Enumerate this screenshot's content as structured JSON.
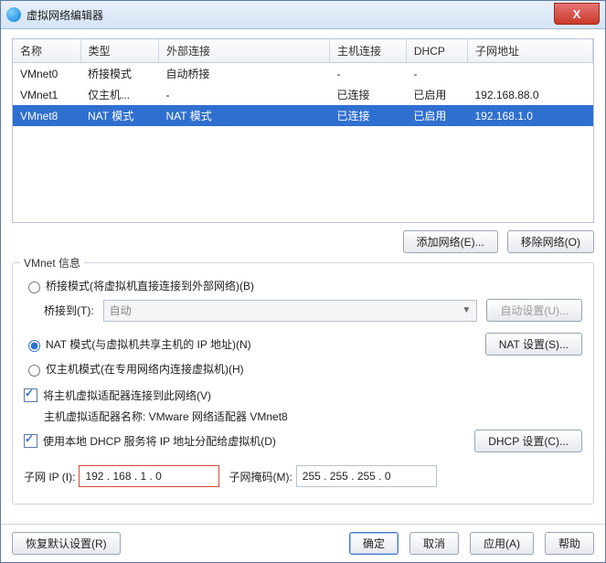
{
  "window": {
    "title": "虚拟网络编辑器",
    "close": "X"
  },
  "table": {
    "headers": {
      "name": "名称",
      "type": "类型",
      "ext": "外部连接",
      "host": "主机连接",
      "dhcp": "DHCP",
      "subnet": "子网地址"
    },
    "rows": [
      {
        "name": "VMnet0",
        "type": "桥接模式",
        "ext": "自动桥接",
        "host": "-",
        "dhcp": "-",
        "subnet": ""
      },
      {
        "name": "VMnet1",
        "type": "仅主机...",
        "ext": "-",
        "host": "已连接",
        "dhcp": "已启用",
        "subnet": "192.168.88.0"
      },
      {
        "name": "VMnet8",
        "type": "NAT 模式",
        "ext": "NAT 模式",
        "host": "已连接",
        "dhcp": "已启用",
        "subnet": "192.168.1.0"
      }
    ]
  },
  "buttons": {
    "add_net": "添加网络(E)...",
    "remove_net": "移除网络(O)",
    "auto_set": "自动设置(U)...",
    "nat_set": "NAT 设置(S)...",
    "dhcp_set": "DHCP 设置(C)...",
    "restore": "恢复默认设置(R)",
    "ok": "确定",
    "cancel": "取消",
    "apply": "应用(A)",
    "help": "帮助"
  },
  "group": {
    "title": "VMnet 信息"
  },
  "radio": {
    "bridge": "桥接模式(将虚拟机直接连接到外部网络)(B)",
    "bridge_to": "桥接到(T):",
    "bridge_combo": "自动",
    "nat": "NAT 模式(与虚拟机共享主机的 IP 地址)(N)",
    "hostonly": "仅主机模式(在专用网络内连接虚拟机)(H)"
  },
  "checks": {
    "connect_adapter": "将主机虚拟适配器连接到此网络(V)",
    "adapter_line": "主机虚拟适配器名称: VMware 网络适配器 VMnet8",
    "use_dhcp": "使用本地 DHCP 服务将 IP 地址分配给虚拟机(D)"
  },
  "subnet": {
    "ip_label": "子网 IP (I):",
    "ip_value": "192 . 168 .  1  .  0",
    "mask_label": "子网掩码(M):",
    "mask_value": "255 . 255 . 255 .  0"
  }
}
